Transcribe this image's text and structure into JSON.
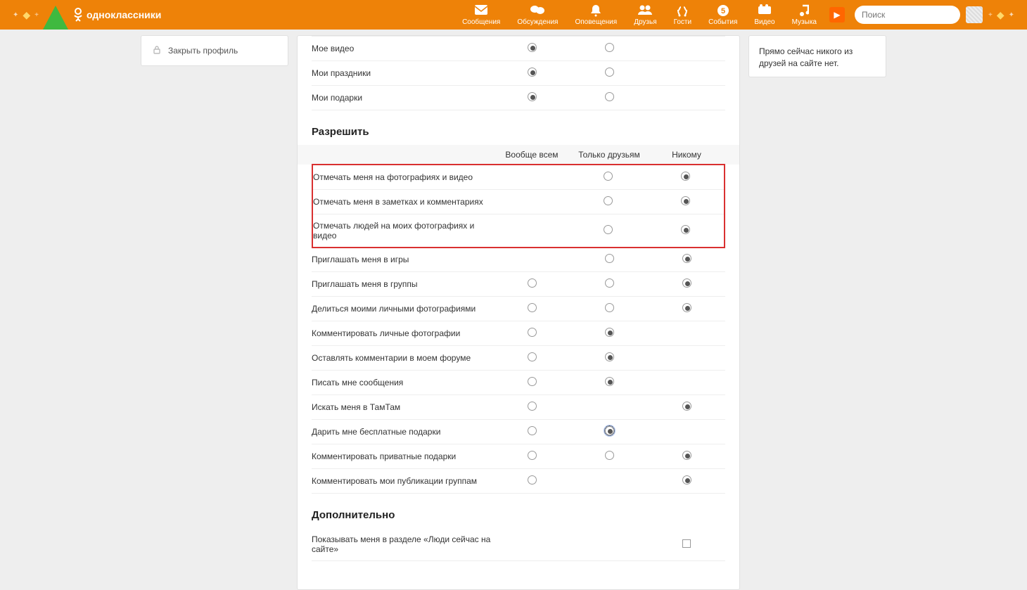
{
  "header": {
    "brand": "одноклассники",
    "nav": [
      {
        "key": "messages",
        "label": "Сообщения"
      },
      {
        "key": "discussions",
        "label": "Обсуждения"
      },
      {
        "key": "notifications",
        "label": "Оповещения"
      },
      {
        "key": "friends",
        "label": "Друзья"
      },
      {
        "key": "guests",
        "label": "Гости"
      },
      {
        "key": "events",
        "label": "События"
      },
      {
        "key": "video",
        "label": "Видео"
      },
      {
        "key": "music",
        "label": "Музыка"
      }
    ],
    "search_placeholder": "Поиск"
  },
  "left_sidebar": {
    "close_profile": "Закрыть профиль"
  },
  "right_sidebar": {
    "text": "Прямо сейчас никого из друзей на сайте нет."
  },
  "visibility_section": {
    "rows": [
      {
        "label": "Мое видео",
        "selected": 0
      },
      {
        "label": "Мои праздники",
        "selected": 0
      },
      {
        "label": "Мои подарки",
        "selected": 0
      }
    ],
    "cols": 2
  },
  "allow_section": {
    "title": "Разрешить",
    "columns": [
      {
        "label": "Вообще всем"
      },
      {
        "label": "Только друзьям"
      },
      {
        "label": "Никому"
      }
    ],
    "highlighted_rows": [
      {
        "label": "Отмечать меня на фотографиях и видео",
        "radios": [
          null,
          0,
          1
        ]
      },
      {
        "label": "Отмечать меня в заметках и комментариях",
        "radios": [
          null,
          0,
          1
        ]
      },
      {
        "label": "Отмечать людей на моих фотографиях и видео",
        "radios": [
          null,
          0,
          1
        ]
      }
    ],
    "rows": [
      {
        "label": "Приглашать меня в игры",
        "radios": [
          null,
          0,
          1
        ]
      },
      {
        "label": "Приглашать меня в группы",
        "radios": [
          0,
          0,
          1
        ]
      },
      {
        "label": "Делиться моими личными фотографиями",
        "radios": [
          0,
          0,
          1
        ]
      },
      {
        "label": "Комментировать личные фотографии",
        "radios": [
          0,
          1,
          null
        ]
      },
      {
        "label": "Оставлять комментарии в моем форуме",
        "radios": [
          0,
          1,
          null
        ]
      },
      {
        "label": "Писать мне сообщения",
        "radios": [
          0,
          1,
          null
        ]
      },
      {
        "label": "Искать меня в ТамТам",
        "radios": [
          0,
          null,
          1
        ]
      },
      {
        "label": "Дарить мне бесплатные подарки",
        "radios": [
          0,
          2,
          null
        ]
      },
      {
        "label": "Комментировать приватные подарки",
        "radios": [
          0,
          0,
          1
        ]
      },
      {
        "label": "Комментировать мои публикации группам",
        "radios": [
          0,
          null,
          1
        ]
      }
    ]
  },
  "additional_section": {
    "title": "Дополнительно",
    "rows": [
      {
        "label": "Показывать меня в разделе «Люди сейчас на сайте»",
        "checked": false
      }
    ]
  }
}
